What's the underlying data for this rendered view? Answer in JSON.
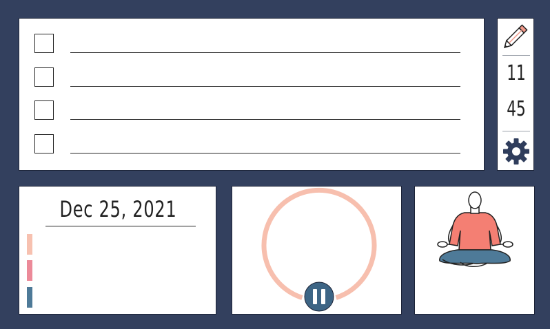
{
  "todo": {
    "items": [
      {
        "checked": false,
        "text": ""
      },
      {
        "checked": false,
        "text": ""
      },
      {
        "checked": false,
        "text": ""
      },
      {
        "checked": false,
        "text": ""
      }
    ]
  },
  "side": {
    "edit_icon": "pencil-icon",
    "time_hours": "11",
    "time_minutes": "45",
    "settings_icon": "gear-icon"
  },
  "date_panel": {
    "date": "Dec 25, 2021",
    "tag_colors": [
      "#f7c1b0",
      "#ec8a99",
      "#4e7a98"
    ]
  },
  "timer": {
    "ring_color": "#f7bfae",
    "button_icon": "pause-icon",
    "button_color": "#3d6585"
  },
  "meditation": {
    "icon": "meditation-person-icon",
    "shirt_color": "#f47f73",
    "pants_color": "#4e7a98"
  }
}
